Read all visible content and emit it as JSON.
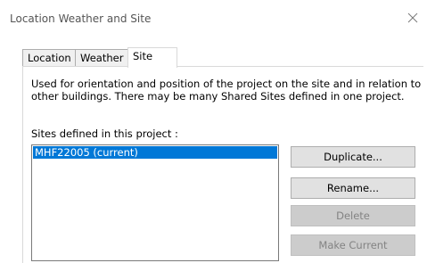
{
  "window": {
    "title": "Location Weather and Site"
  },
  "tabs": [
    {
      "label": "Location",
      "active": false
    },
    {
      "label": "Weather",
      "active": false
    },
    {
      "label": "Site",
      "active": true
    }
  ],
  "site_panel": {
    "description": "Used for orientation and position of the project on the site and in relation to other buildings. There may be many Shared Sites defined in one project.",
    "list_label": "Sites defined in this project :",
    "sites": [
      {
        "name": "MHF22005 (current)",
        "selected": true
      }
    ],
    "buttons": {
      "duplicate": {
        "label": "Duplicate...",
        "enabled": true
      },
      "rename": {
        "label": "Rename...",
        "enabled": true
      },
      "delete": {
        "label": "Delete",
        "enabled": false
      },
      "make_current": {
        "label": "Make Current",
        "enabled": false
      }
    }
  },
  "colors": {
    "selection": "#0078d7",
    "button_face": "#e1e1e1",
    "disabled_button_face": "#cccccc",
    "disabled_text": "#838383"
  },
  "icons": {
    "close": "close-icon"
  }
}
